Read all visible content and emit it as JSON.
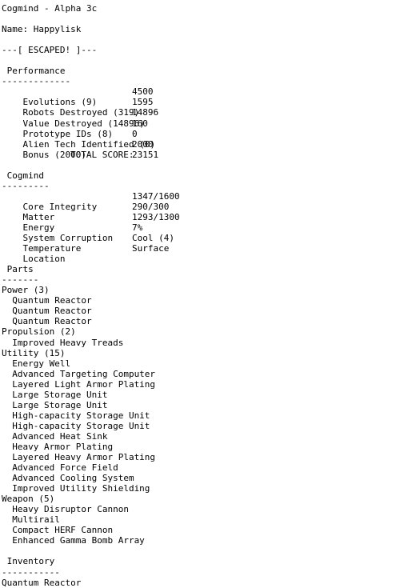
{
  "header": {
    "game_title": "Cogmind - Alpha 3c",
    "name_label": "Name: Happylisk",
    "status_banner": "---[ ESCAPED! ]---"
  },
  "performance": {
    "title": " Performance",
    "rule": "-------------",
    "rows": [
      {
        "label": "Evolutions (9)",
        "value": "4500"
      },
      {
        "label": "Robots Destroyed (319)",
        "value": "1595"
      },
      {
        "label": "Value Destroyed (14896)",
        "value": "14896"
      },
      {
        "label": "Prototype IDs (8)",
        "value": "160"
      },
      {
        "label": "Alien Tech Identified (0)",
        "value": "0"
      },
      {
        "label": "Bonus (2000)",
        "value": "2000"
      }
    ],
    "total_label": "TOTAL SCORE:",
    "total_value": "23151"
  },
  "cogmind": {
    "title": " Cogmind",
    "rule": "---------",
    "rows": [
      {
        "label": "Core Integrity",
        "value": "1347/1600"
      },
      {
        "label": "Matter",
        "value": "290/300"
      },
      {
        "label": "Energy",
        "value": "1293/1300"
      },
      {
        "label": "System Corruption",
        "value": "7%"
      },
      {
        "label": "Temperature",
        "value": "Cool (4)"
      },
      {
        "label": "Location",
        "value": "Surface"
      }
    ]
  },
  "parts": {
    "title": " Parts",
    "rule": "-------",
    "groups": [
      {
        "heading": "Power (3)",
        "items": [
          "  Quantum Reactor",
          "  Quantum Reactor",
          "  Quantum Reactor"
        ]
      },
      {
        "heading": "Propulsion (2)",
        "items": [
          "  Improved Heavy Treads"
        ]
      },
      {
        "heading": "Utility (15)",
        "items": [
          "  Energy Well",
          "  Advanced Targeting Computer",
          "  Layered Light Armor Plating",
          "  Large Storage Unit",
          "  Large Storage Unit",
          "  High-capacity Storage Unit",
          "  High-capacity Storage Unit",
          "  Advanced Heat Sink",
          "  Heavy Armor Plating",
          "  Layered Heavy Armor Plating",
          "  Advanced Force Field",
          "  Advanced Cooling System",
          "  Improved Utility Shielding"
        ]
      },
      {
        "heading": "Weapon (5)",
        "items": [
          "  Heavy Disruptor Cannon",
          "  Multirail",
          "  Compact HERF Cannon",
          "  Enhanced Gamma Bomb Array"
        ]
      }
    ]
  },
  "inventory": {
    "title": " Inventory",
    "rule": "-----------",
    "items": [
      "Quantum Reactor"
    ]
  }
}
